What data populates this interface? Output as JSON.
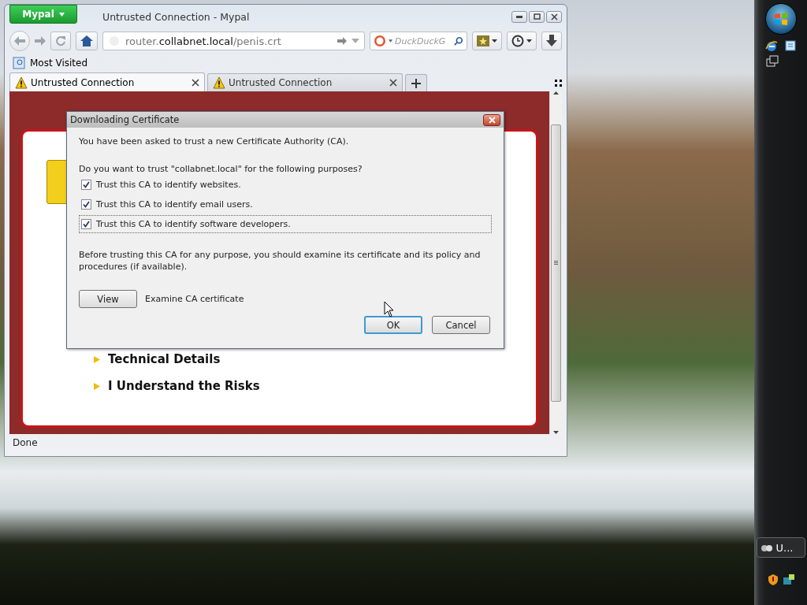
{
  "browser": {
    "menu_button": "Mypal",
    "title": "Untrusted Connection - Mypal",
    "address": {
      "host_prefix": "router.",
      "domain": "collabnet.local",
      "path": "/penis.crt"
    },
    "search": {
      "placeholder": "DuckDuckG"
    },
    "bookmarks": [
      {
        "label": "Most Visited"
      }
    ],
    "tabs": [
      {
        "label": "Untrusted Connection",
        "selected": true
      },
      {
        "label": "Untrusted Connection",
        "selected": false
      }
    ],
    "page": {
      "links": [
        "Technical Details",
        "I Understand the Risks"
      ]
    },
    "status_bar": "Done"
  },
  "dialog": {
    "title": "Downloading Certificate",
    "intro": "You have been asked to trust a new Certificate Authority (CA).",
    "question": "Do you want to trust \"collabnet.local\" for the following purposes?",
    "options": [
      {
        "label": "Trust this CA to identify websites.",
        "checked": true,
        "focused": false
      },
      {
        "label": "Trust this CA to identify email users.",
        "checked": true,
        "focused": false
      },
      {
        "label": "Trust this CA to identify software developers.",
        "checked": true,
        "focused": true
      }
    ],
    "note": "Before trusting this CA for any purpose, you should examine its certificate and its policy and procedures (if available).",
    "view_button": "View",
    "view_label": "Examine CA certificate",
    "buttons": [
      {
        "label": "OK",
        "default": true
      },
      {
        "label": "Cancel",
        "default": false
      }
    ]
  },
  "taskbar": {
    "tasks": [
      {
        "label": "U..."
      }
    ]
  }
}
